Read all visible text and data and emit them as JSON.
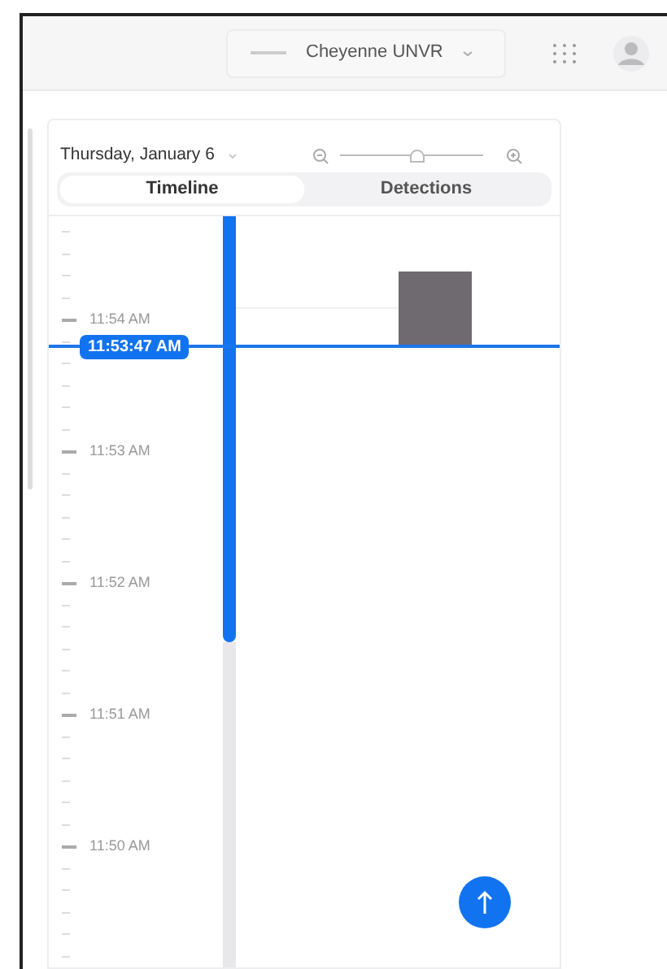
{
  "header": {
    "device_selector": {
      "label": "Cheyenne UNVR"
    }
  },
  "timeline_panel": {
    "date": "Thursday, January 6",
    "zoom": {
      "level": 0.55
    },
    "tabs": [
      {
        "label": "Timeline",
        "selected": true
      },
      {
        "label": "Detections",
        "selected": false
      }
    ],
    "time_labels": [
      "11:54 AM",
      "11:53 AM",
      "11:52 AM",
      "11:51 AM",
      "11:50 AM"
    ],
    "current_time": "11:53:47 AM"
  }
}
